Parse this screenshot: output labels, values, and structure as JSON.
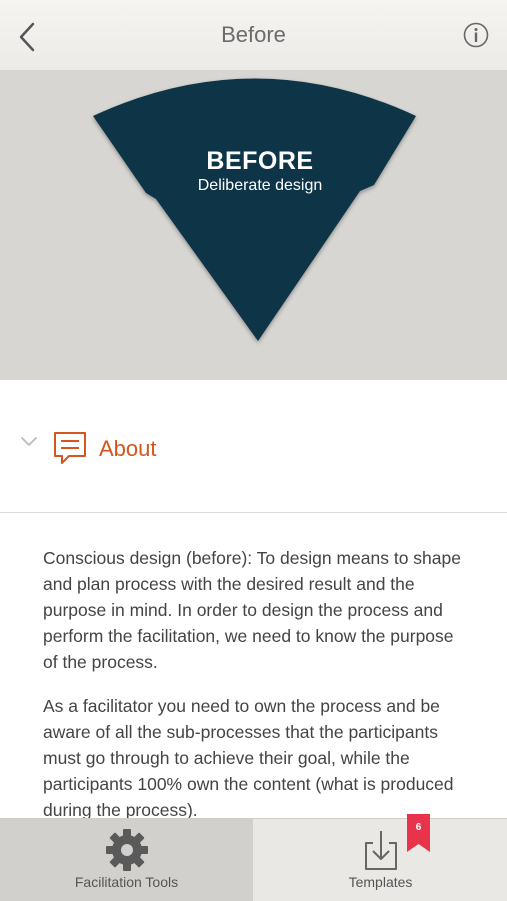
{
  "header": {
    "title": "Before",
    "back_icon": "chevron-left-icon",
    "info_icon": "info-icon"
  },
  "hero": {
    "title": "BEFORE",
    "subtitle": "Deliberate design",
    "shape_color": "#0f3446",
    "background_color": "#d7d6d3"
  },
  "section": {
    "label": "About",
    "chevron_icon": "chevron-down-icon",
    "speech_icon": "speech-bubble-icon",
    "accent_color": "#d2561d"
  },
  "content": {
    "paragraph1": "Conscious design (before): To design means to shape and plan process with the desired result and the purpose in mind. In order to design the process and perform the facilitation, we need to know the purpose of the process.",
    "paragraph2": "As a facilitator you need to own the process and be aware of all the sub-processes that the participants must go through to achieve their goal, while the participants 100% own the content (what is produced during the process)."
  },
  "tabs": [
    {
      "label": "Facilitation Tools",
      "icon": "gear-icon",
      "active": true
    },
    {
      "label": "Templates",
      "icon": "download-tray-icon",
      "active": false,
      "badge": "6"
    }
  ],
  "badge_color": "#e8334a"
}
